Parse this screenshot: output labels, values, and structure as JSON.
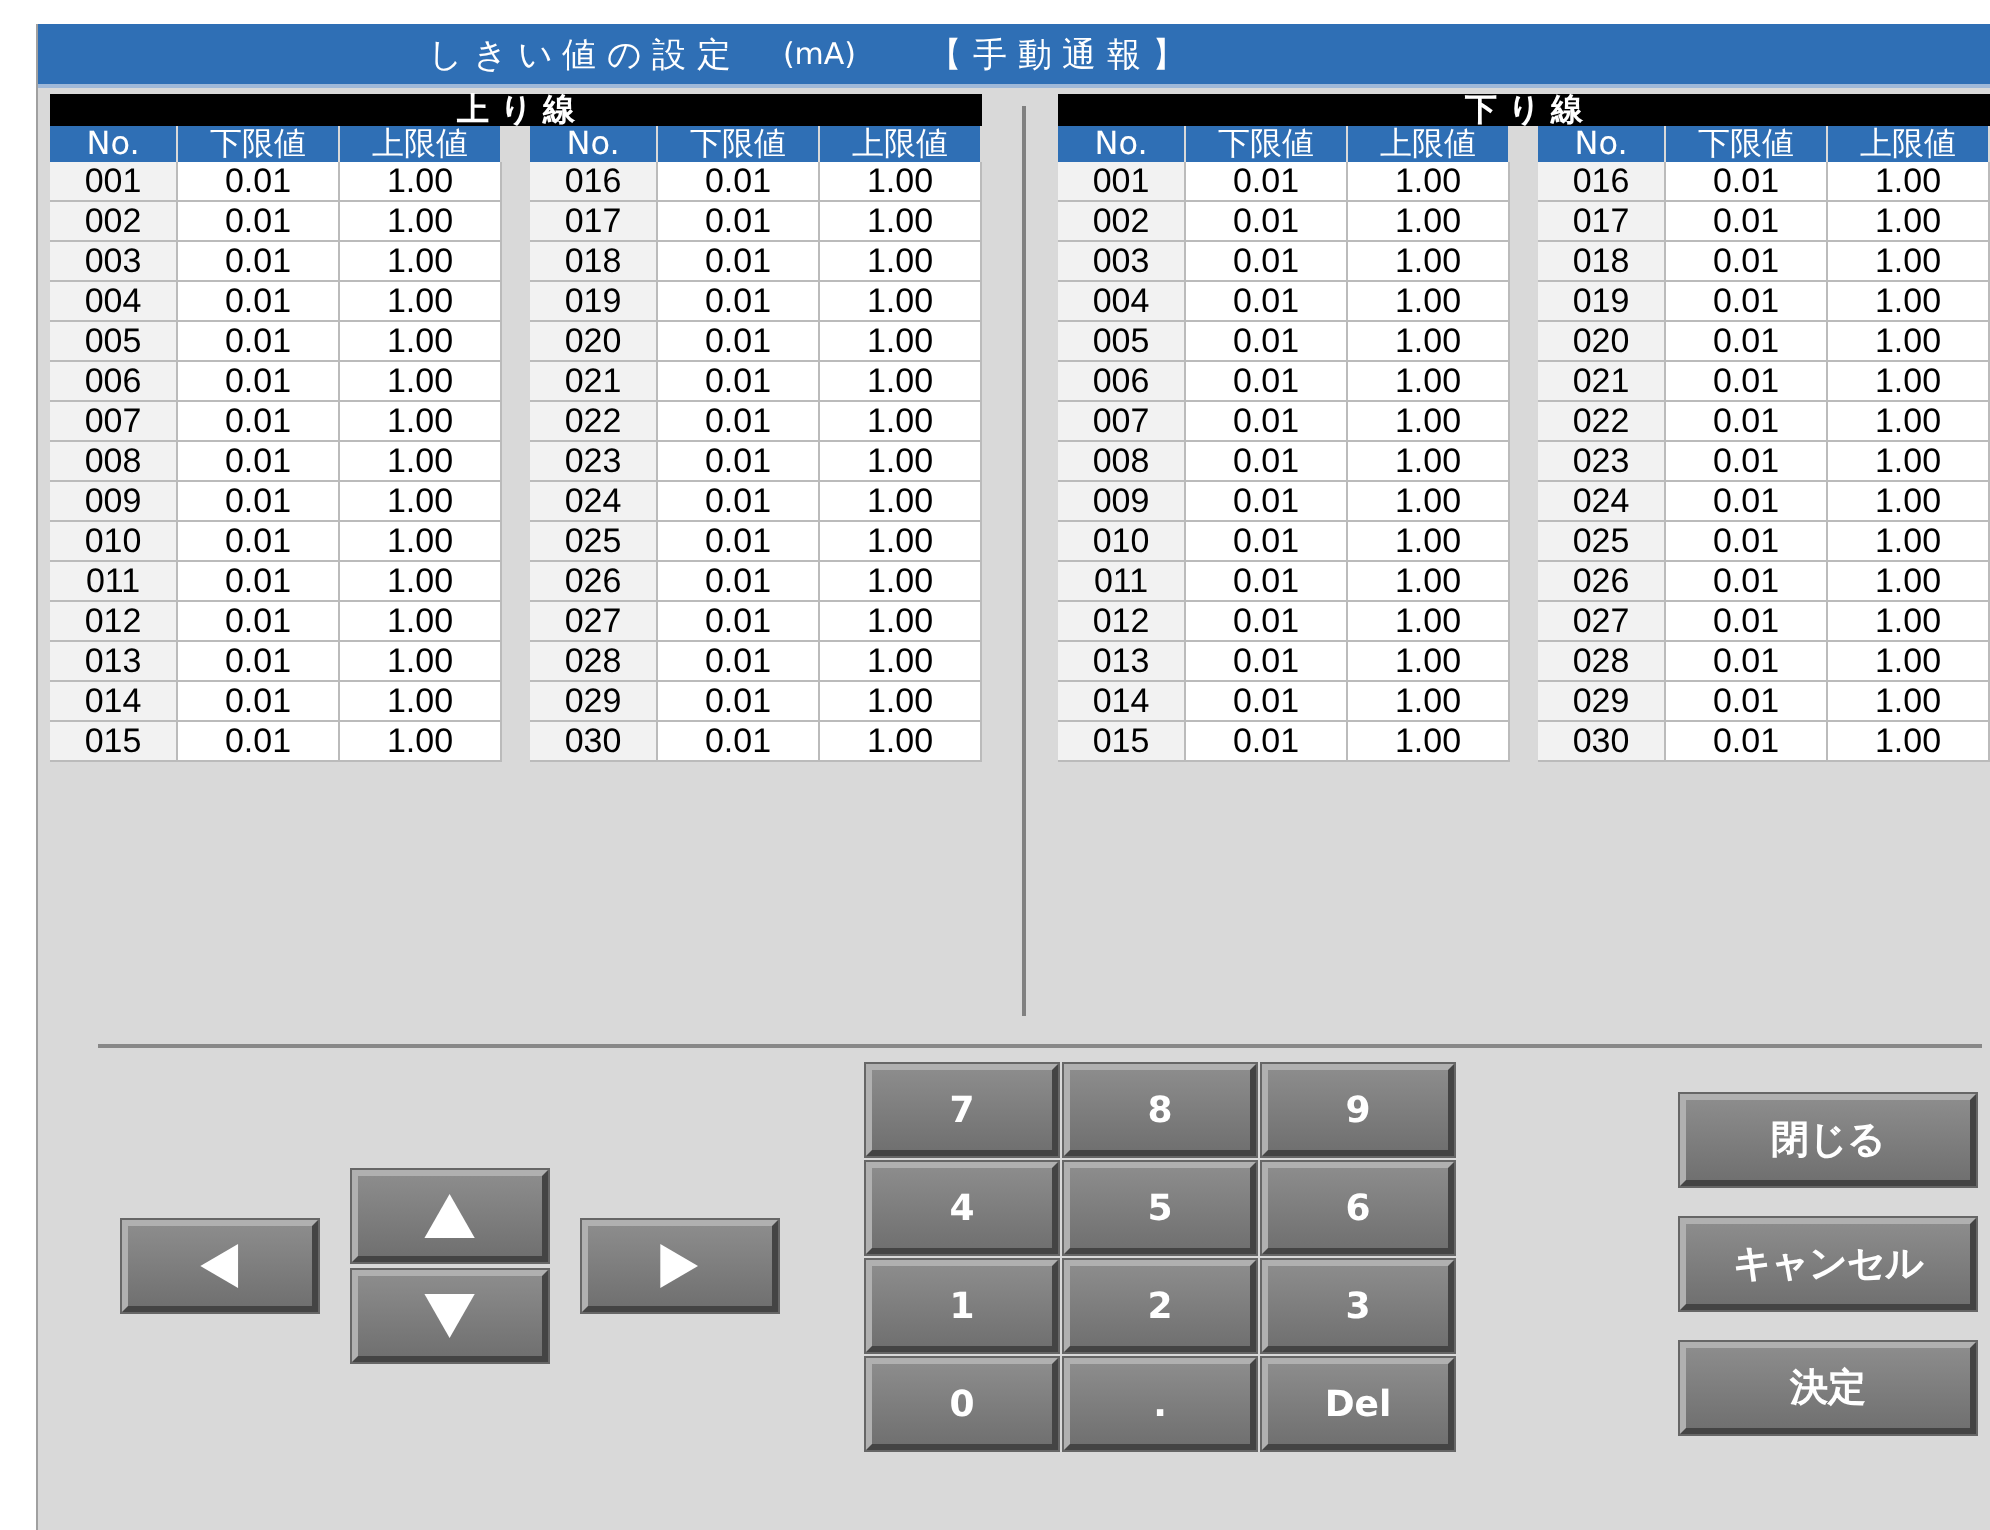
{
  "title": {
    "main": "し き い 値 の 設 定",
    "unit": "(mA)",
    "mode": "【 手 動 通 報 】"
  },
  "sections": [
    {
      "heading": "上 り 線",
      "tables": [
        {
          "columns": [
            "No.",
            "下限値",
            "上限値"
          ],
          "rows": [
            [
              "001",
              "0.01",
              "1.00"
            ],
            [
              "002",
              "0.01",
              "1.00"
            ],
            [
              "003",
              "0.01",
              "1.00"
            ],
            [
              "004",
              "0.01",
              "1.00"
            ],
            [
              "005",
              "0.01",
              "1.00"
            ],
            [
              "006",
              "0.01",
              "1.00"
            ],
            [
              "007",
              "0.01",
              "1.00"
            ],
            [
              "008",
              "0.01",
              "1.00"
            ],
            [
              "009",
              "0.01",
              "1.00"
            ],
            [
              "010",
              "0.01",
              "1.00"
            ],
            [
              "011",
              "0.01",
              "1.00"
            ],
            [
              "012",
              "0.01",
              "1.00"
            ],
            [
              "013",
              "0.01",
              "1.00"
            ],
            [
              "014",
              "0.01",
              "1.00"
            ],
            [
              "015",
              "0.01",
              "1.00"
            ]
          ]
        },
        {
          "columns": [
            "No.",
            "下限値",
            "上限値"
          ],
          "rows": [
            [
              "016",
              "0.01",
              "1.00"
            ],
            [
              "017",
              "0.01",
              "1.00"
            ],
            [
              "018",
              "0.01",
              "1.00"
            ],
            [
              "019",
              "0.01",
              "1.00"
            ],
            [
              "020",
              "0.01",
              "1.00"
            ],
            [
              "021",
              "0.01",
              "1.00"
            ],
            [
              "022",
              "0.01",
              "1.00"
            ],
            [
              "023",
              "0.01",
              "1.00"
            ],
            [
              "024",
              "0.01",
              "1.00"
            ],
            [
              "025",
              "0.01",
              "1.00"
            ],
            [
              "026",
              "0.01",
              "1.00"
            ],
            [
              "027",
              "0.01",
              "1.00"
            ],
            [
              "028",
              "0.01",
              "1.00"
            ],
            [
              "029",
              "0.01",
              "1.00"
            ],
            [
              "030",
              "0.01",
              "1.00"
            ]
          ]
        }
      ]
    },
    {
      "heading": "下 り 線",
      "tables": [
        {
          "columns": [
            "No.",
            "下限値",
            "上限値"
          ],
          "rows": [
            [
              "001",
              "0.01",
              "1.00"
            ],
            [
              "002",
              "0.01",
              "1.00"
            ],
            [
              "003",
              "0.01",
              "1.00"
            ],
            [
              "004",
              "0.01",
              "1.00"
            ],
            [
              "005",
              "0.01",
              "1.00"
            ],
            [
              "006",
              "0.01",
              "1.00"
            ],
            [
              "007",
              "0.01",
              "1.00"
            ],
            [
              "008",
              "0.01",
              "1.00"
            ],
            [
              "009",
              "0.01",
              "1.00"
            ],
            [
              "010",
              "0.01",
              "1.00"
            ],
            [
              "011",
              "0.01",
              "1.00"
            ],
            [
              "012",
              "0.01",
              "1.00"
            ],
            [
              "013",
              "0.01",
              "1.00"
            ],
            [
              "014",
              "0.01",
              "1.00"
            ],
            [
              "015",
              "0.01",
              "1.00"
            ]
          ]
        },
        {
          "columns": [
            "No.",
            "下限値",
            "上限値"
          ],
          "rows": [
            [
              "016",
              "0.01",
              "1.00"
            ],
            [
              "017",
              "0.01",
              "1.00"
            ],
            [
              "018",
              "0.01",
              "1.00"
            ],
            [
              "019",
              "0.01",
              "1.00"
            ],
            [
              "020",
              "0.01",
              "1.00"
            ],
            [
              "021",
              "0.01",
              "1.00"
            ],
            [
              "022",
              "0.01",
              "1.00"
            ],
            [
              "023",
              "0.01",
              "1.00"
            ],
            [
              "024",
              "0.01",
              "1.00"
            ],
            [
              "025",
              "0.01",
              "1.00"
            ],
            [
              "026",
              "0.01",
              "1.00"
            ],
            [
              "027",
              "0.01",
              "1.00"
            ],
            [
              "028",
              "0.01",
              "1.00"
            ],
            [
              "029",
              "0.01",
              "1.00"
            ],
            [
              "030",
              "0.01",
              "1.00"
            ]
          ]
        }
      ]
    }
  ],
  "nav_buttons": [
    {
      "kind": "left"
    },
    {
      "kind": "up"
    },
    {
      "kind": "down"
    },
    {
      "kind": "right"
    }
  ],
  "keypad": [
    "7",
    "8",
    "9",
    "4",
    "5",
    "6",
    "1",
    "2",
    "3",
    "0",
    ".",
    "Del"
  ],
  "actions": [
    "閉じる",
    "キャンセル",
    "決定"
  ]
}
